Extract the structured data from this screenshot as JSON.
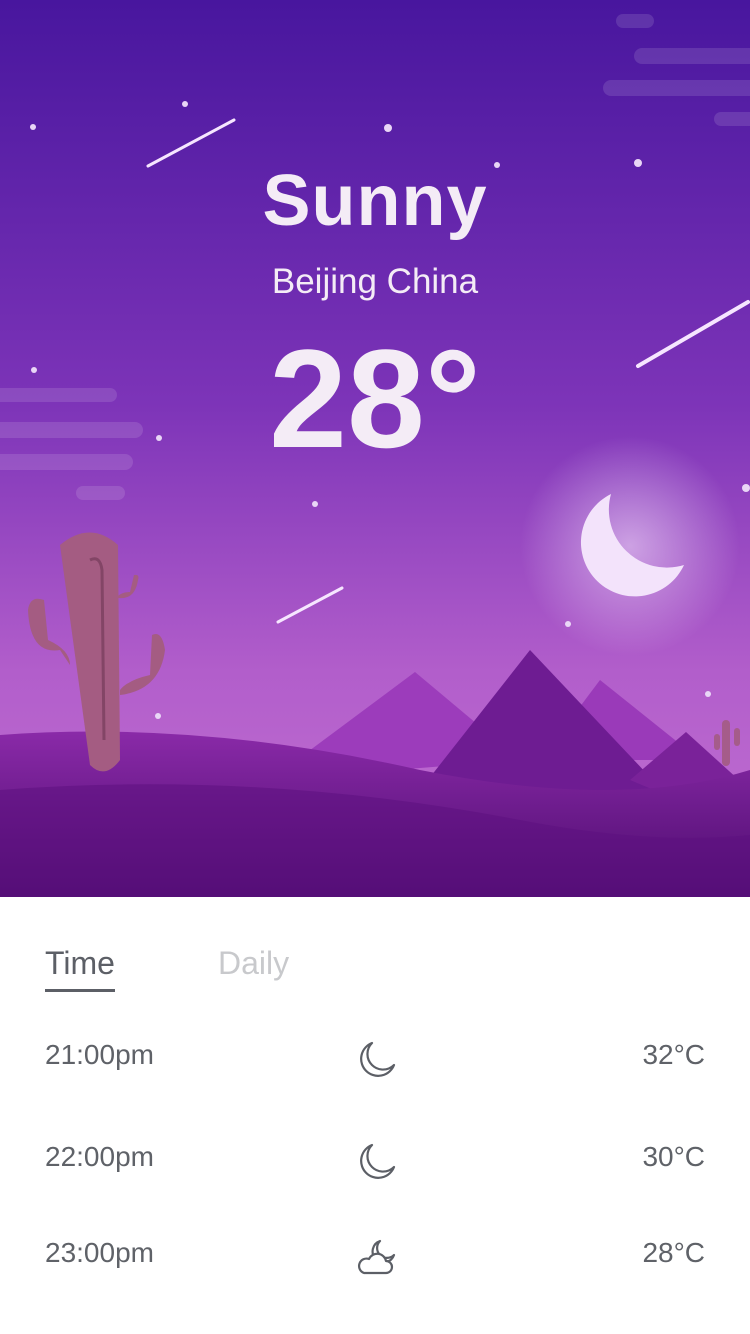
{
  "weather": {
    "condition": "Sunny",
    "location": "Beijing China",
    "temperature": "28°"
  },
  "tabs": [
    {
      "label": "Time",
      "active": true
    },
    {
      "label": "Daily",
      "active": false
    }
  ],
  "hourly": [
    {
      "time": "21:00pm",
      "icon": "moon-icon",
      "temp": "32°C"
    },
    {
      "time": "22:00pm",
      "icon": "moon-icon",
      "temp": "30°C"
    },
    {
      "time": "23:00pm",
      "icon": "cloudy-night-icon",
      "temp": "28°C"
    }
  ],
  "colors": {
    "sky_top": "#48169e",
    "sky_bottom": "#c070d0",
    "ground": "#7a1f98",
    "text_primary": "#5c5f66",
    "text_inactive": "#c8c9cc"
  }
}
